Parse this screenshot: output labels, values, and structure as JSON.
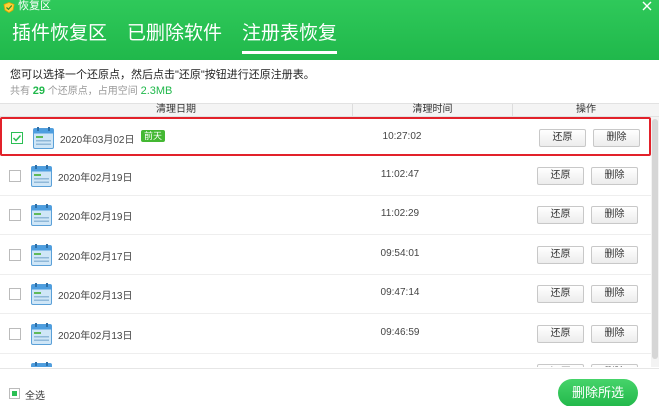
{
  "window": {
    "title": "恢复区"
  },
  "tabs": [
    {
      "label": "插件恢复区",
      "active": false
    },
    {
      "label": "已删除软件",
      "active": false
    },
    {
      "label": "注册表恢复",
      "active": true
    }
  ],
  "info": {
    "instruction": "您可以选择一个还原点，然后点击\"还原\"按钮进行还原注册表。",
    "summary_prefix": "共有",
    "count": "29",
    "summary_middle": "个还原点，占用空间",
    "size": "2.3MB"
  },
  "table": {
    "columns": {
      "date": "清理日期",
      "time": "清理时间",
      "action": "操作"
    },
    "restore_label": "还原",
    "delete_label": "删除",
    "rows": [
      {
        "date": "2020年03月02日",
        "badge": "前天",
        "time": "10:27:02",
        "checked": true
      },
      {
        "date": "2020年02月19日",
        "badge": "",
        "time": "11:02:47",
        "checked": false
      },
      {
        "date": "2020年02月19日",
        "badge": "",
        "time": "11:02:29",
        "checked": false
      },
      {
        "date": "2020年02月17日",
        "badge": "",
        "time": "09:54:01",
        "checked": false
      },
      {
        "date": "2020年02月13日",
        "badge": "",
        "time": "09:47:14",
        "checked": false
      },
      {
        "date": "2020年02月13日",
        "badge": "",
        "time": "09:46:59",
        "checked": false
      },
      {
        "date": "",
        "badge": "",
        "time": "",
        "checked": false
      }
    ]
  },
  "footer": {
    "select_all": "全选",
    "delete_selected": "删除所选"
  },
  "colors": {
    "brand": "#20b84b",
    "highlight": "#e2212a",
    "badge": "#44b833"
  },
  "icons": {
    "app": "shield-logo-icon",
    "close": "close-icon",
    "row": "registry-file-icon",
    "check": "checkmark-icon"
  }
}
